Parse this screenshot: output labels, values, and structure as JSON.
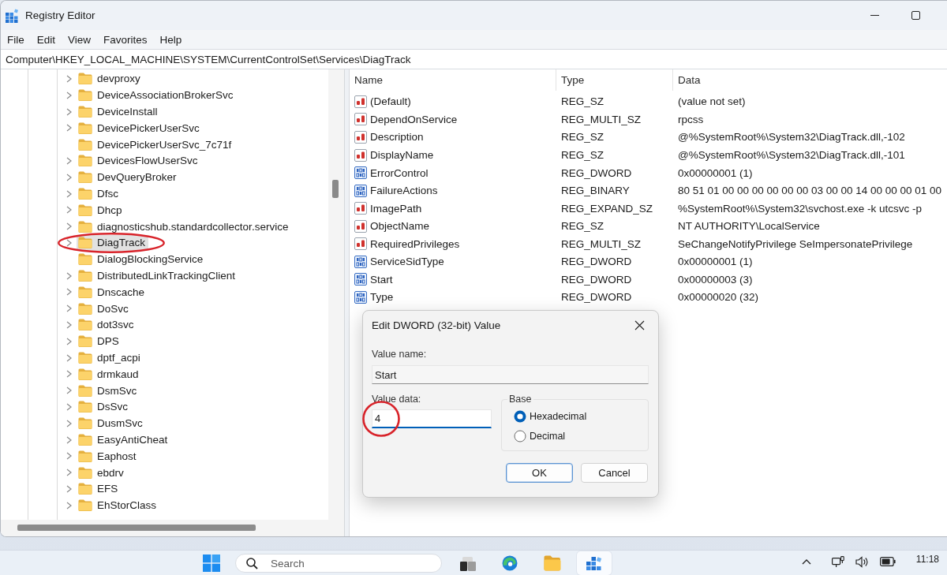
{
  "window": {
    "title": "Registry Editor"
  },
  "menu": [
    {
      "label": "File"
    },
    {
      "label": "Edit"
    },
    {
      "label": "View"
    },
    {
      "label": "Favorites"
    },
    {
      "label": "Help"
    }
  ],
  "address_bar": {
    "value": "Computer\\HKEY_LOCAL_MACHINE\\SYSTEM\\CurrentControlSet\\Services\\DiagTrack"
  },
  "tree": {
    "items": [
      {
        "label": "devproxy",
        "expandable": true,
        "selected": false,
        "circled": false
      },
      {
        "label": "DeviceAssociationBrokerSvc",
        "expandable": true,
        "selected": false,
        "circled": false
      },
      {
        "label": "DeviceInstall",
        "expandable": true,
        "selected": false,
        "circled": false
      },
      {
        "label": "DevicePickerUserSvc",
        "expandable": true,
        "selected": false,
        "circled": false
      },
      {
        "label": "DevicePickerUserSvc_7c71f",
        "expandable": false,
        "selected": false,
        "circled": false
      },
      {
        "label": "DevicesFlowUserSvc",
        "expandable": true,
        "selected": false,
        "circled": false
      },
      {
        "label": "DevQueryBroker",
        "expandable": true,
        "selected": false,
        "circled": false
      },
      {
        "label": "Dfsc",
        "expandable": true,
        "selected": false,
        "circled": false
      },
      {
        "label": "Dhcp",
        "expandable": true,
        "selected": false,
        "circled": false
      },
      {
        "label": "diagnosticshub.standardcollector.service",
        "expandable": true,
        "selected": false,
        "circled": false
      },
      {
        "label": "DiagTrack",
        "expandable": true,
        "selected": true,
        "circled": true
      },
      {
        "label": "DialogBlockingService",
        "expandable": false,
        "selected": false,
        "circled": false
      },
      {
        "label": "DistributedLinkTrackingClient",
        "expandable": true,
        "selected": false,
        "circled": false
      },
      {
        "label": "Dnscache",
        "expandable": true,
        "selected": false,
        "circled": false
      },
      {
        "label": "DoSvc",
        "expandable": true,
        "selected": false,
        "circled": false
      },
      {
        "label": "dot3svc",
        "expandable": true,
        "selected": false,
        "circled": false
      },
      {
        "label": "DPS",
        "expandable": true,
        "selected": false,
        "circled": false
      },
      {
        "label": "dptf_acpi",
        "expandable": true,
        "selected": false,
        "circled": false
      },
      {
        "label": "drmkaud",
        "expandable": true,
        "selected": false,
        "circled": false
      },
      {
        "label": "DsmSvc",
        "expandable": true,
        "selected": false,
        "circled": false
      },
      {
        "label": "DsSvc",
        "expandable": true,
        "selected": false,
        "circled": false
      },
      {
        "label": "DusmSvc",
        "expandable": true,
        "selected": false,
        "circled": false
      },
      {
        "label": "EasyAntiCheat",
        "expandable": true,
        "selected": false,
        "circled": false
      },
      {
        "label": "Eaphost",
        "expandable": true,
        "selected": false,
        "circled": false
      },
      {
        "label": "ebdrv",
        "expandable": true,
        "selected": false,
        "circled": false
      },
      {
        "label": "EFS",
        "expandable": true,
        "selected": false,
        "circled": false
      },
      {
        "label": "EhStorClass",
        "expandable": true,
        "selected": false,
        "circled": false
      }
    ]
  },
  "values": {
    "columns": [
      {
        "label": "Name"
      },
      {
        "label": "Type"
      },
      {
        "label": "Data"
      }
    ],
    "rows": [
      {
        "kind": "string",
        "name": "(Default)",
        "type": "REG_SZ",
        "data": "(value not set)"
      },
      {
        "kind": "string",
        "name": "DependOnService",
        "type": "REG_MULTI_SZ",
        "data": "rpcss"
      },
      {
        "kind": "string",
        "name": "Description",
        "type": "REG_SZ",
        "data": "@%SystemRoot%\\System32\\DiagTrack.dll,-102"
      },
      {
        "kind": "string",
        "name": "DisplayName",
        "type": "REG_SZ",
        "data": "@%SystemRoot%\\System32\\DiagTrack.dll,-101"
      },
      {
        "kind": "binary",
        "name": "ErrorControl",
        "type": "REG_DWORD",
        "data": "0x00000001 (1)"
      },
      {
        "kind": "binary",
        "name": "FailureActions",
        "type": "REG_BINARY",
        "data": "80 51 01 00 00 00 00 00 00 03 00 00 14 00 00 00 01 00"
      },
      {
        "kind": "string",
        "name": "ImagePath",
        "type": "REG_EXPAND_SZ",
        "data": "%SystemRoot%\\System32\\svchost.exe -k utcsvc -p"
      },
      {
        "kind": "string",
        "name": "ObjectName",
        "type": "REG_SZ",
        "data": "NT AUTHORITY\\LocalService"
      },
      {
        "kind": "string",
        "name": "RequiredPrivileges",
        "type": "REG_MULTI_SZ",
        "data": "SeChangeNotifyPrivilege SeImpersonatePrivilege"
      },
      {
        "kind": "binary",
        "name": "ServiceSidType",
        "type": "REG_DWORD",
        "data": "0x00000001 (1)"
      },
      {
        "kind": "binary",
        "name": "Start",
        "type": "REG_DWORD",
        "data": "0x00000003 (3)"
      },
      {
        "kind": "binary",
        "name": "Type",
        "type": "REG_DWORD",
        "data": "0x00000020 (32)"
      }
    ]
  },
  "dialog": {
    "title": "Edit DWORD (32-bit) Value",
    "value_name_label": "Value name:",
    "value_name": "Start",
    "value_data_label": "Value data:",
    "value_data": "4",
    "value_data_circled": true,
    "base_label": "Base",
    "base_options": [
      {
        "label": "Hexadecimal",
        "selected": true
      },
      {
        "label": "Decimal",
        "selected": false
      }
    ],
    "buttons": [
      {
        "label": "OK",
        "kind": "primary"
      },
      {
        "label": "Cancel",
        "kind": "secondary"
      }
    ]
  },
  "taskbar": {
    "search": {
      "placeholder": "Search"
    },
    "apps": [
      {
        "kind": "tiles",
        "active": false
      },
      {
        "kind": "browser",
        "active": false
      },
      {
        "kind": "folder",
        "active": false
      },
      {
        "kind": "blocks",
        "active": true
      }
    ],
    "clock": "11:18"
  }
}
